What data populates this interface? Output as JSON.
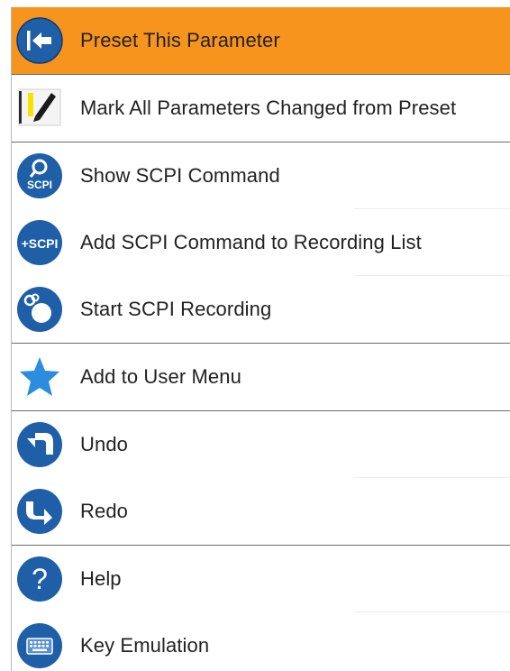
{
  "menu": {
    "items": [
      {
        "label": "Preset This Parameter",
        "icon": "preset-arrow-icon"
      },
      {
        "label": "Mark All Parameters Changed from Preset",
        "icon": "highlighter-pen-icon"
      },
      {
        "label": "Show SCPI Command",
        "icon": "scpi-search-icon"
      },
      {
        "label": "Add SCPI Command to Recording List",
        "icon": "scpi-add-icon"
      },
      {
        "label": "Start SCPI Recording",
        "icon": "scpi-record-icon"
      },
      {
        "label": "Add to User Menu",
        "icon": "star-icon"
      },
      {
        "label": "Undo",
        "icon": "undo-icon"
      },
      {
        "label": "Redo",
        "icon": "redo-icon"
      },
      {
        "label": "Help",
        "icon": "help-icon"
      },
      {
        "label": "Key Emulation",
        "icon": "keyboard-icon"
      }
    ]
  },
  "icons": {
    "scpi_text": "SCPI",
    "scpi_plus_text": "+SCPI",
    "help_text": "?"
  },
  "colors": {
    "selected_bg": "#f7941d",
    "icon_blue": "#1f5fa8",
    "star_blue": "#2b8de0"
  }
}
